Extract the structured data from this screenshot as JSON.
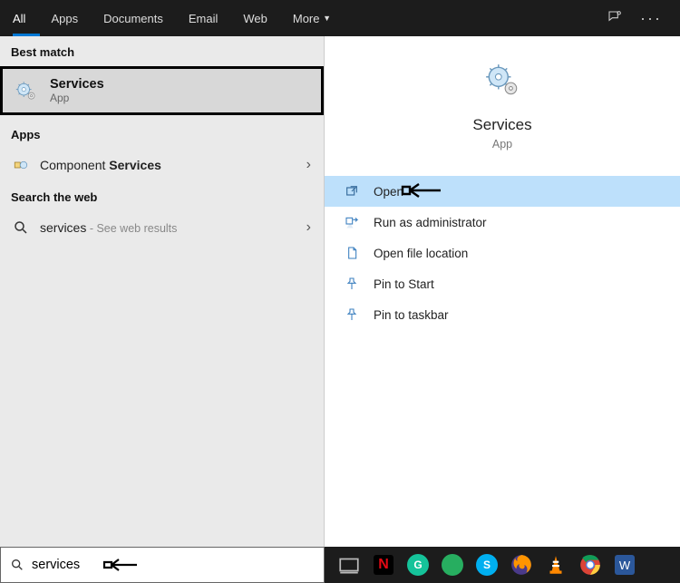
{
  "tabs": {
    "all": "All",
    "apps": "Apps",
    "documents": "Documents",
    "email": "Email",
    "web": "Web",
    "more": "More"
  },
  "left": {
    "best_label": "Best match",
    "best_title": "Services",
    "best_sub": "App",
    "apps_label": "Apps",
    "comp_prefix": "Component ",
    "comp_bold": "Services",
    "web_label": "Search the web",
    "web_query": "services",
    "web_suffix": " - See web results"
  },
  "preview": {
    "title": "Services",
    "sub": "App"
  },
  "actions": {
    "open": "Open",
    "run_admin": "Run as administrator",
    "open_loc": "Open file location",
    "pin_start": "Pin to Start",
    "pin_taskbar": "Pin to taskbar"
  },
  "search": {
    "value": "services"
  }
}
